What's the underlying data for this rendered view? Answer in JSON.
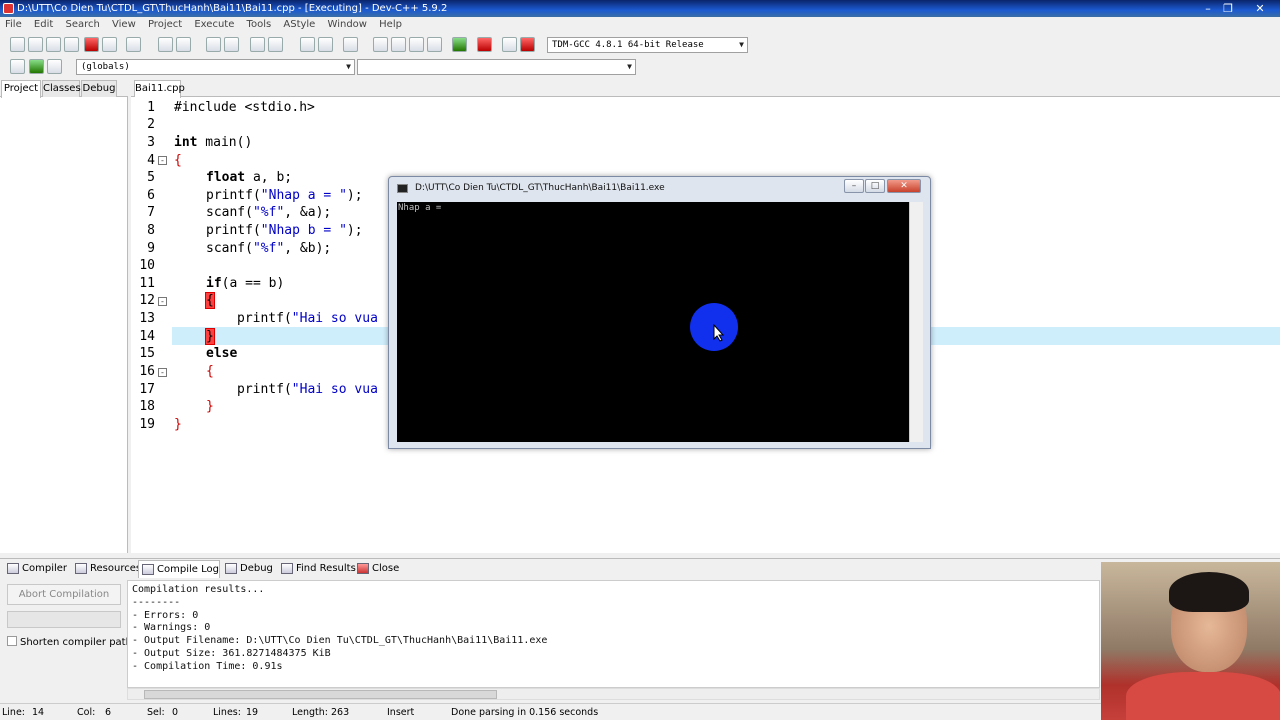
{
  "window": {
    "title": "D:\\UTT\\Co Dien Tu\\CTDL_GT\\ThucHanh\\Bai11\\Bai11.cpp - [Executing] - Dev-C++ 5.9.2"
  },
  "menu": [
    "File",
    "Edit",
    "Search",
    "View",
    "Project",
    "Execute",
    "Tools",
    "AStyle",
    "Window",
    "Help"
  ],
  "toolbar": {
    "compiler_select": "TDM-GCC 4.8.1 64-bit Release",
    "scope_select": "(globals)",
    "member_select": ""
  },
  "left_tabs": [
    "Project",
    "Classes",
    "Debug"
  ],
  "editor": {
    "file_tab": "Bai11.cpp",
    "line_numbers": [
      "1",
      "2",
      "3",
      "4",
      "5",
      "6",
      "7",
      "8",
      "9",
      "10",
      "11",
      "12",
      "13",
      "14",
      "15",
      "16",
      "17",
      "18",
      "19"
    ],
    "lines": {
      "l1": "#include <stdio.h>",
      "l3a": "int",
      "l3b": " main()",
      "l4": "{",
      "l5a": "float",
      "l5b": " a, b;",
      "l6a": "printf(",
      "l6b": "\"Nhap a = \"",
      "l6c": ");",
      "l7a": "scanf(",
      "l7b": "\"%f\"",
      "l7c": ", &a);",
      "l8a": "printf(",
      "l8b": "\"Nhap b = \"",
      "l8c": ");",
      "l9a": "scanf(",
      "l9b": "\"%f\"",
      "l9c": ", &b);",
      "l11a": "if",
      "l11b": "(a == b)",
      "l12": "{",
      "l13a": "printf(",
      "l13b": "\"Hai so vua",
      "l14": "}",
      "l15": "else",
      "l16": "{",
      "l17a": "printf(",
      "l17b": "\"Hai so vua",
      "l18": "}",
      "l19": "}"
    }
  },
  "console": {
    "title": "D:\\UTT\\Co Dien Tu\\CTDL_GT\\ThucHanh\\Bai11\\Bai11.exe",
    "output": "Nhap a = "
  },
  "bottom_tabs": [
    "Compiler",
    "Resources",
    "Compile Log",
    "Debug",
    "Find Results",
    "Close"
  ],
  "compile": {
    "abort_label": "Abort Compilation",
    "shorten_label": "Shorten compiler paths",
    "log": "Compilation results...\n--------\n- Errors: 0\n- Warnings: 0\n- Output Filename: D:\\UTT\\Co Dien Tu\\CTDL_GT\\ThucHanh\\Bai11\\Bai11.exe\n- Output Size: 361.8271484375 KiB\n- Compilation Time: 0.91s"
  },
  "status": {
    "line_label": "Line:",
    "line": "14",
    "col_label": "Col:",
    "col": "6",
    "sel_label": "Sel:",
    "sel": "0",
    "lines_label": "Lines:",
    "lines": "19",
    "length_label": "Length:",
    "length": "263",
    "mode": "Insert",
    "message": "Done parsing in 0.156 seconds"
  },
  "colors": {
    "titlebar": "#1c5bd1",
    "string": "#0000c8",
    "current_line": "#cfeefc",
    "brace_match": "#ff4040",
    "cursor_highlight": "#1030ee"
  }
}
